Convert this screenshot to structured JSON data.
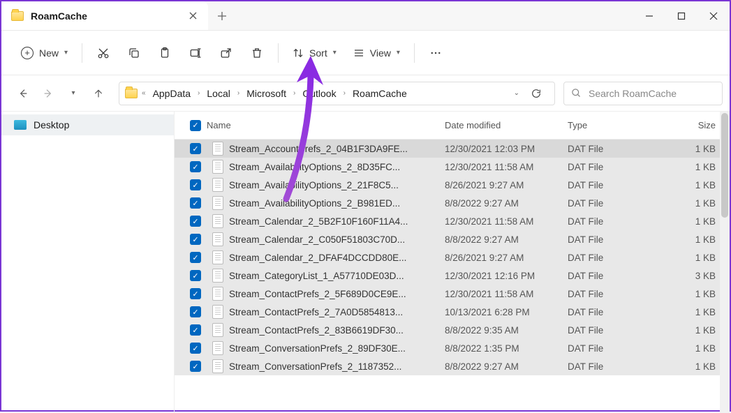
{
  "tab": {
    "title": "RoamCache"
  },
  "toolbar": {
    "new_label": "New",
    "sort_label": "Sort",
    "view_label": "View"
  },
  "breadcrumbs": {
    "prefix": "«",
    "items": [
      "AppData",
      "Local",
      "Microsoft",
      "Outlook",
      "RoamCache"
    ]
  },
  "search": {
    "placeholder": "Search RoamCache"
  },
  "sidebar": {
    "items": [
      {
        "label": "Desktop"
      }
    ]
  },
  "columns": {
    "name": "Name",
    "date": "Date modified",
    "type": "Type",
    "size": "Size"
  },
  "files": [
    {
      "name": "Stream_AccountPrefs_2_04B1F3DA9FE...",
      "date": "12/30/2021 12:03 PM",
      "type": "DAT File",
      "size": "1 KB"
    },
    {
      "name": "Stream_AvailabilityOptions_2_8D35FC...",
      "date": "12/30/2021 11:58 AM",
      "type": "DAT File",
      "size": "1 KB"
    },
    {
      "name": "Stream_AvailabilityOptions_2_21F8C5...",
      "date": "8/26/2021 9:27 AM",
      "type": "DAT File",
      "size": "1 KB"
    },
    {
      "name": "Stream_AvailabilityOptions_2_B981ED...",
      "date": "8/8/2022 9:27 AM",
      "type": "DAT File",
      "size": "1 KB"
    },
    {
      "name": "Stream_Calendar_2_5B2F10F160F11A4...",
      "date": "12/30/2021 11:58 AM",
      "type": "DAT File",
      "size": "1 KB"
    },
    {
      "name": "Stream_Calendar_2_C050F51803C70D...",
      "date": "8/8/2022 9:27 AM",
      "type": "DAT File",
      "size": "1 KB"
    },
    {
      "name": "Stream_Calendar_2_DFAF4DCCDD80E...",
      "date": "8/26/2021 9:27 AM",
      "type": "DAT File",
      "size": "1 KB"
    },
    {
      "name": "Stream_CategoryList_1_A57710DE03D...",
      "date": "12/30/2021 12:16 PM",
      "type": "DAT File",
      "size": "3 KB"
    },
    {
      "name": "Stream_ContactPrefs_2_5F689D0CE9E...",
      "date": "12/30/2021 11:58 AM",
      "type": "DAT File",
      "size": "1 KB"
    },
    {
      "name": "Stream_ContactPrefs_2_7A0D5854813...",
      "date": "10/13/2021 6:28 PM",
      "type": "DAT File",
      "size": "1 KB"
    },
    {
      "name": "Stream_ContactPrefs_2_83B6619DF30...",
      "date": "8/8/2022 9:35 AM",
      "type": "DAT File",
      "size": "1 KB"
    },
    {
      "name": "Stream_ConversationPrefs_2_89DF30E...",
      "date": "8/8/2022 1:35 PM",
      "type": "DAT File",
      "size": "1 KB"
    },
    {
      "name": "Stream_ConversationPrefs_2_1187352...",
      "date": "8/8/2022 9:27 AM",
      "type": "DAT File",
      "size": "1 KB"
    }
  ]
}
